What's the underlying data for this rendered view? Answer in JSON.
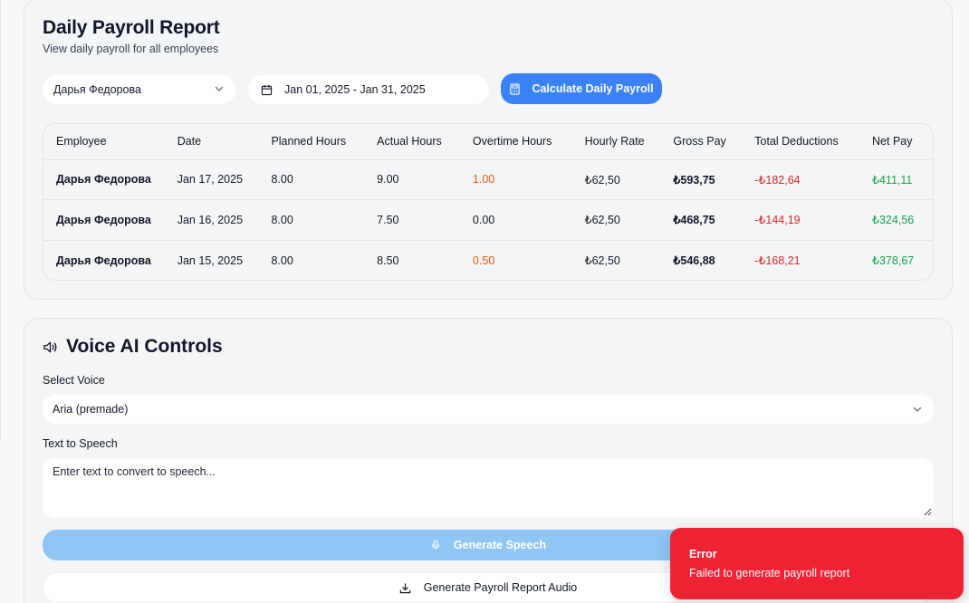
{
  "payroll": {
    "title": "Daily Payroll Report",
    "subtitle": "View daily payroll for all employees",
    "employee_select": "Дарья Федорова",
    "date_range": "Jan 01, 2025 - Jan 31, 2025",
    "calculate_label": "Calculate Daily Payroll",
    "columns": [
      "Employee",
      "Date",
      "Planned Hours",
      "Actual Hours",
      "Overtime Hours",
      "Hourly Rate",
      "Gross Pay",
      "Total Deductions",
      "Net Pay"
    ],
    "rows": [
      {
        "employee": "Дарья Федорова",
        "date": "Jan 17, 2025",
        "planned": "8.00",
        "actual": "9.00",
        "overtime": "1.00",
        "rate": "₺62,50",
        "gross": "₺593,75",
        "deductions": "-₺182,64",
        "net": "₺411,11"
      },
      {
        "employee": "Дарья Федорова",
        "date": "Jan 16, 2025",
        "planned": "8.00",
        "actual": "7.50",
        "overtime": "0.00",
        "rate": "₺62,50",
        "gross": "₺468,75",
        "deductions": "-₺144,19",
        "net": "₺324,56"
      },
      {
        "employee": "Дарья Федорова",
        "date": "Jan 15, 2025",
        "planned": "8.00",
        "actual": "8.50",
        "overtime": "0.50",
        "rate": "₺62,50",
        "gross": "₺546,88",
        "deductions": "-₺168,21",
        "net": "₺378,67"
      }
    ]
  },
  "voice": {
    "title": "Voice AI Controls",
    "select_label": "Select Voice",
    "selected_voice": "Aria (premade)",
    "tts_label": "Text to Speech",
    "tts_placeholder": "Enter text to convert to speech...",
    "generate_label": "Generate Speech",
    "audio_label": "Generate Payroll Report Audio"
  },
  "toast": {
    "title": "Error",
    "message": "Failed to generate payroll report"
  },
  "colors": {
    "accent": "#3b82f6",
    "accent_disabled": "#8ec5f3",
    "overtime": "#ea580c",
    "deduction": "#dc2626",
    "net": "#16a34a",
    "error": "#f02235"
  },
  "icons": {
    "calendar": "calendar-icon",
    "calculator": "calculator-icon",
    "speaker": "speaker-icon",
    "mic": "mic-icon",
    "download": "download-icon",
    "chevron": "chevron-down-icon"
  }
}
